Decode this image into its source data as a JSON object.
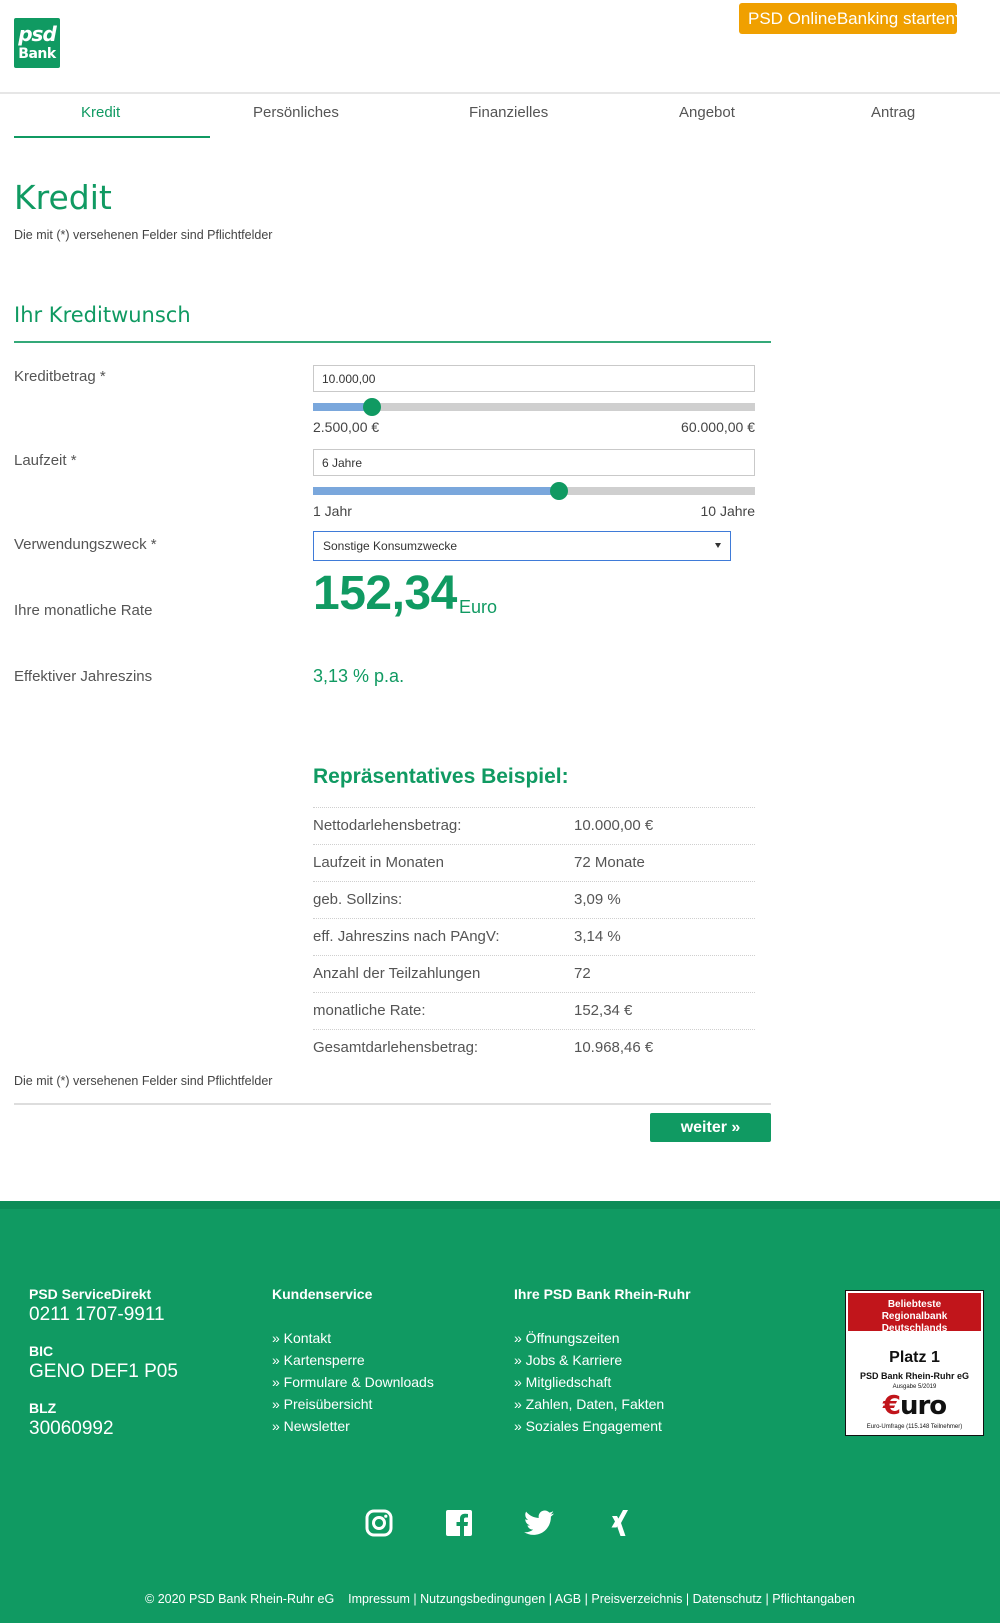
{
  "header": {
    "logo_line1": "psd",
    "logo_line2": "Bank",
    "onlinebanking_label": "PSD OnlineBanking starten"
  },
  "nav": {
    "tabs": [
      {
        "label": "Kredit",
        "active": true
      },
      {
        "label": "Persönliches",
        "active": false
      },
      {
        "label": "Finanzielles",
        "active": false
      },
      {
        "label": "Angebot",
        "active": false
      },
      {
        "label": "Antrag",
        "active": false
      }
    ]
  },
  "main": {
    "title": "Kredit",
    "required_note": "Die mit (*) versehenen Felder sind Pflichtfelder",
    "section_title": "Ihr Kreditwunsch",
    "kreditbetrag": {
      "label": "Kreditbetrag *",
      "value": "10.000,00",
      "min_label": "2.500,00 €",
      "max_label": "60.000,00 €",
      "slider_fraction": 0.133
    },
    "laufzeit": {
      "label": "Laufzeit *",
      "value": "6 Jahre",
      "min_label": "1 Jahr",
      "max_label": "10 Jahre",
      "slider_fraction": 0.556
    },
    "verwendungszweck": {
      "label": "Verwendungszweck *",
      "value": "Sonstige Konsumzwecke"
    },
    "monthly_rate": {
      "label": "Ihre monatliche Rate",
      "value": "152,34",
      "unit": "Euro"
    },
    "effective_rate": {
      "label": "Effektiver Jahreszins",
      "value": "3,13 % p.a."
    },
    "example": {
      "title": "Repräsentatives Beispiel:",
      "rows": [
        {
          "key": "Nettodarlehensbetrag:",
          "value": "10.000,00 €"
        },
        {
          "key": "Laufzeit in Monaten",
          "value": "72 Monate"
        },
        {
          "key": "geb. Sollzins:",
          "value": "3,09 %"
        },
        {
          "key": "eff. Jahreszins nach PAngV:",
          "value": "3,14 %"
        },
        {
          "key": "Anzahl der Teilzahlungen",
          "value": "72"
        },
        {
          "key": "monatliche Rate:",
          "value": "152,34 €"
        },
        {
          "key": "Gesamtdarlehensbetrag:",
          "value": "10.968,46 €"
        }
      ]
    },
    "required_note_bottom": "Die mit (*) versehenen Felder sind Pflichtfelder",
    "next_button": "weiter »"
  },
  "footer": {
    "service_title": "PSD ServiceDirekt",
    "service_phone": "0211 1707-9911",
    "bic_label": "BIC",
    "bic_value": "GENO DEF1 P05",
    "blz_label": "BLZ",
    "blz_value": "30060992",
    "kundenservice_title": "Kundenservice",
    "kundenservice_links": [
      "» Kontakt",
      "» Kartensperre",
      "» Formulare & Downloads",
      "» Preisübersicht",
      "» Newsletter"
    ],
    "bank_title": "Ihre PSD Bank Rhein-Ruhr",
    "bank_links": [
      "» Öffnungszeiten",
      "» Jobs & Karriere",
      "» Mitgliedschaft",
      "» Zahlen, Daten, Fakten",
      "» Soziales Engagement"
    ],
    "badge": {
      "line1": "Beliebteste",
      "line2": "Regionalbank Deutschlands",
      "place": "Platz 1",
      "bank": "PSD Bank Rhein-Ruhr eG",
      "issue": "Ausgabe 5/2019",
      "magazine_symbol": "€",
      "magazine_rest": "uro",
      "survey": "Euro-Umfrage (115.148 Teilnehmer)"
    },
    "social_icons": [
      "instagram-icon",
      "facebook-icon",
      "twitter-icon",
      "xing-icon"
    ],
    "copyright": "© 2020 PSD Bank Rhein-Ruhr eG",
    "legal_links": [
      "Impressum",
      "Nutzungsbedingungen",
      "AGB",
      "Preisverzeichnis",
      "Datenschutz",
      "Pflichtangaben"
    ]
  },
  "colors": {
    "brand_green": "#109a62",
    "accent_orange": "#f0a000",
    "slider_blue": "#7aa7dc",
    "badge_red": "#c1151b"
  }
}
